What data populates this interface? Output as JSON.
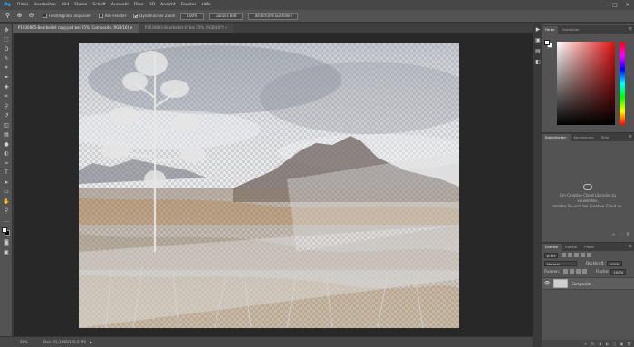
{
  "app": {
    "logo": "Ps"
  },
  "menu": [
    "Datei",
    "Bearbeiten",
    "Bild",
    "Ebene",
    "Schrift",
    "Auswahl",
    "Filter",
    "3D",
    "Ansicht",
    "Fenster",
    "Hilfe"
  ],
  "window_controls": [
    "–",
    "□",
    "✕"
  ],
  "options": {
    "fit_window_label": "Fenstergröße anpassen",
    "fit_window_checked": false,
    "all_windows_label": "Alle Fenster",
    "all_windows_checked": false,
    "scrubby_zoom_label": "Dynamischer Zoom",
    "scrubby_zoom_checked": true,
    "zoom_100_button": "100%",
    "fit_screen_button": "Ganzes Bild",
    "fill_screen_button": "Bildschirm ausfüllen"
  },
  "doc_tabs": [
    {
      "label": "P1030865-Bearbeitet copy.psd bei 25% (Composite, RGB/16) ✕",
      "active": true
    },
    {
      "label": "P1030865-Bearbeitet.tif bei 25% (RGB/16*) ✕",
      "active": false
    }
  ],
  "tools": [
    "move-icon",
    "marquee-icon",
    "lasso-icon",
    "quick-select-icon",
    "crop-icon",
    "eyedropper-icon",
    "healing-icon",
    "brush-icon",
    "stamp-icon",
    "history-brush-icon",
    "eraser-icon",
    "gradient-icon",
    "blur-icon",
    "dodge-icon",
    "pen-icon",
    "type-icon",
    "path-select-icon",
    "shape-icon",
    "hand-icon",
    "zoom-icon",
    "more-tools-icon"
  ],
  "tool_glyphs": [
    "✥",
    "⬚",
    "ʘ",
    "✎",
    "⌗",
    "✒",
    "✚",
    "✏",
    "⚲",
    "↺",
    "◫",
    "▤",
    "●",
    "◐",
    "✑",
    "T",
    "➤",
    "▭",
    "✋",
    "⚲",
    "…"
  ],
  "dock_glyphs": [
    "▶",
    "▣",
    "▤",
    "◧"
  ],
  "status": {
    "zoom": "25%",
    "doc_info": "Dok: 91,3 MB/125,5 MB",
    "arrow": "▶"
  },
  "color_panel": {
    "tabs": [
      "Farbe",
      "Farbfelder"
    ],
    "menu": "≡"
  },
  "library_panel": {
    "tabs": [
      "Bibliotheken",
      "Korrekturen",
      "Stile"
    ],
    "menu": "≡",
    "message_line1": "Um Creative Cloud Libraries zu",
    "message_line2": "verwenden,",
    "message_line3": "melden Sie sich bei Creative Cloud an.",
    "footer_glyphs": [
      "⊕",
      "⬚",
      "🗑"
    ]
  },
  "layers_panel": {
    "tabs": [
      "Ebenen",
      "Kanäle",
      "Pfade"
    ],
    "menu": "≡",
    "filter_kind": "ρ Art",
    "blend_mode": "Normal",
    "opacity_label": "Deckkraft:",
    "opacity_value": "100%",
    "lock_label": "Fixieren:",
    "fill_label": "Fläche:",
    "fill_value": "100%",
    "layers": [
      {
        "name": "Composite",
        "visible": true
      }
    ],
    "eye_glyph": "👁",
    "footer_glyphs": [
      "∞",
      "fx",
      "◑",
      "◐",
      "▢",
      "▣",
      "🗑"
    ]
  }
}
